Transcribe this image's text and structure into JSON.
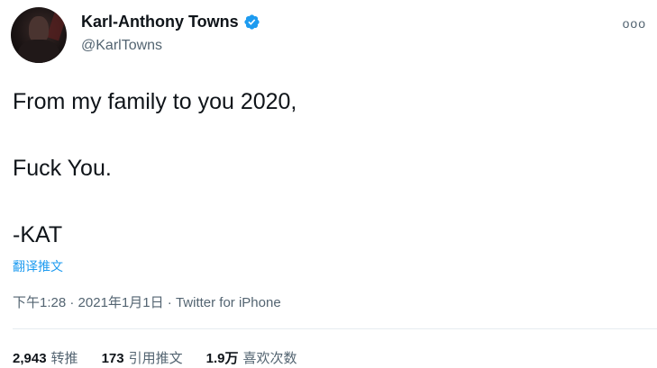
{
  "author": {
    "display_name": "Karl-Anthony Towns",
    "handle": "@KarlTowns",
    "verified": true
  },
  "more_menu_glyph": "ooo",
  "tweet": {
    "lines": [
      "From my family to you 2020,",
      "",
      "Fuck You.",
      "",
      "-KAT"
    ]
  },
  "translate_link": "翻译推文",
  "meta": {
    "time": "下午1:28",
    "separator": "·",
    "date": "2021年1月1日",
    "source": "Twitter for iPhone"
  },
  "stats": [
    {
      "count": "2,943",
      "label": "转推"
    },
    {
      "count": "173",
      "label": "引用推文"
    },
    {
      "count": "1.9万",
      "label": "喜欢次数"
    }
  ],
  "colors": {
    "accent": "#1d9bf0",
    "text": "#0f1419",
    "secondary": "#536471"
  },
  "icons": {
    "verified": "verified-badge-icon",
    "more": "more-options-icon"
  }
}
